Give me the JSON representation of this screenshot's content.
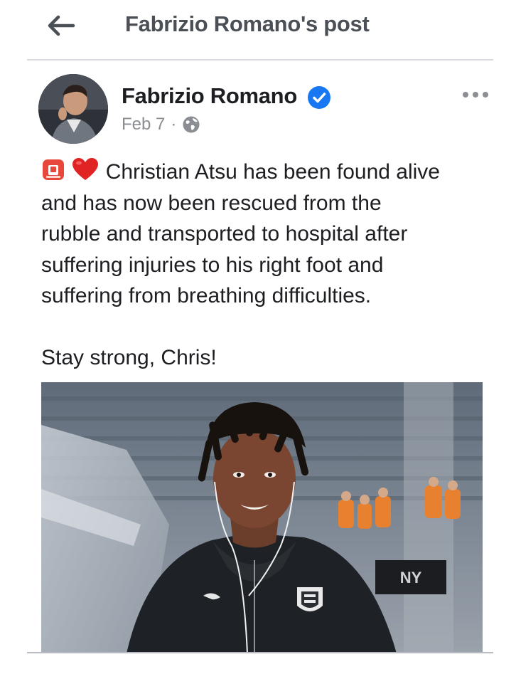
{
  "topbar": {
    "title": "Fabrizio Romano's post",
    "back_icon": "arrow-left-icon"
  },
  "post": {
    "author": "Fabrizio Romano",
    "verified_icon": "verified-badge-icon",
    "date": "Feb 7",
    "separator": "·",
    "audience_icon": "globe-icon",
    "more_icon": "more-horizontal-icon",
    "emojis": [
      "siren-emoji-icon",
      "red-heart-emoji-icon"
    ],
    "text_lines": [
      "Christian Atsu has been found alive",
      "and has now been rescued from the",
      "rubble and transported to hospital after",
      "suffering injuries to his right foot and",
      "suffering from breathing difficulties."
    ],
    "closing_line": "Stay strong, Chris!",
    "photo_icon": "post-photo"
  },
  "colors": {
    "verified": "#1877f2",
    "secondary_text": "#8a8d91",
    "title_text": "#4b4f56"
  }
}
